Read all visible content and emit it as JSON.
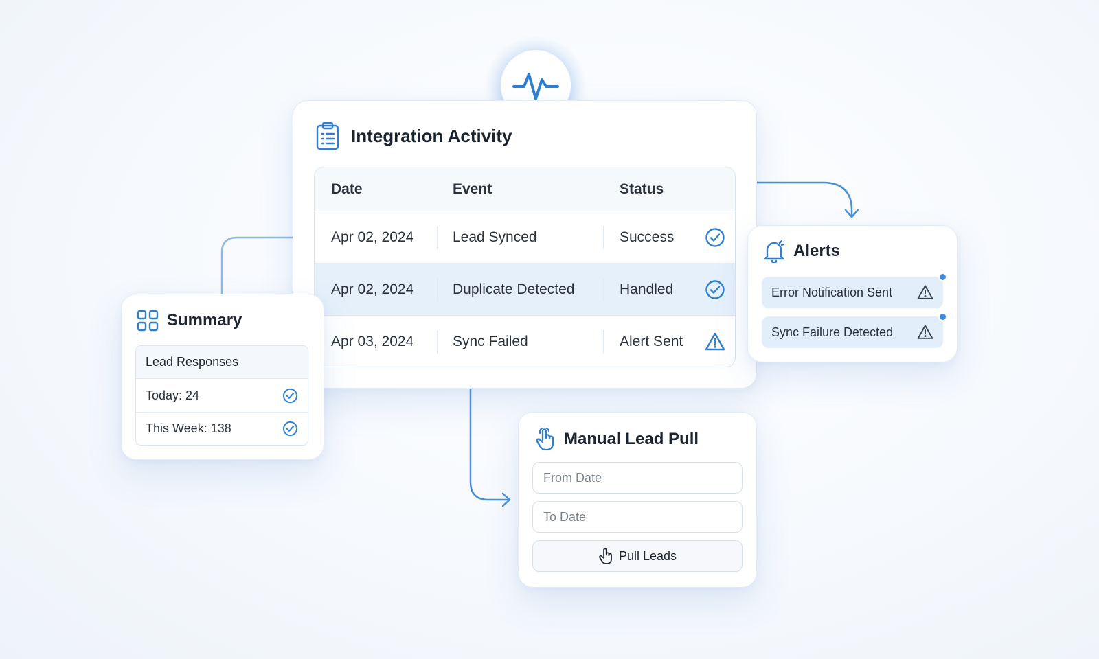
{
  "colors": {
    "accent": "#2f7fd0",
    "accent_light": "#e3eefb",
    "notification_dot": "#3d8ae6"
  },
  "pulse_badge": {
    "icon": "heartbeat-icon"
  },
  "activity": {
    "title": "Integration Activity",
    "icon": "clipboard-list-icon",
    "columns": [
      "Date",
      "Event",
      "Status"
    ],
    "rows": [
      {
        "date": "Apr 02, 2024",
        "event": "Lead Synced",
        "status": "Success",
        "status_icon": "check-circle-icon"
      },
      {
        "date": "Apr 02, 2024",
        "event": "Duplicate Detected",
        "status": "Handled",
        "status_icon": "check-circle-icon",
        "highlighted": true
      },
      {
        "date": "Apr 03, 2024",
        "event": "Sync Failed",
        "status": "Alert Sent",
        "status_icon": "warning-triangle-icon"
      }
    ]
  },
  "summary": {
    "title": "Summary",
    "icon": "grid-icon",
    "box_header": "Lead Responses",
    "items": [
      {
        "label": "Today: 24",
        "icon": "check-circle-icon"
      },
      {
        "label": "This Week: 138",
        "icon": "check-circle-icon"
      }
    ]
  },
  "alerts": {
    "title": "Alerts",
    "icon": "bell-icon",
    "items": [
      {
        "label": "Error Notification Sent",
        "icon": "warning-triangle-icon",
        "unread": true
      },
      {
        "label": "Sync Failure Detected",
        "icon": "warning-triangle-icon",
        "unread": true
      }
    ]
  },
  "manual_pull": {
    "title": "Manual Lead Pull",
    "icon": "hand-pointer-icon",
    "from_placeholder": "From Date",
    "to_placeholder": "To Date",
    "button_label": "Pull Leads",
    "button_icon": "hand-pointer-icon"
  }
}
